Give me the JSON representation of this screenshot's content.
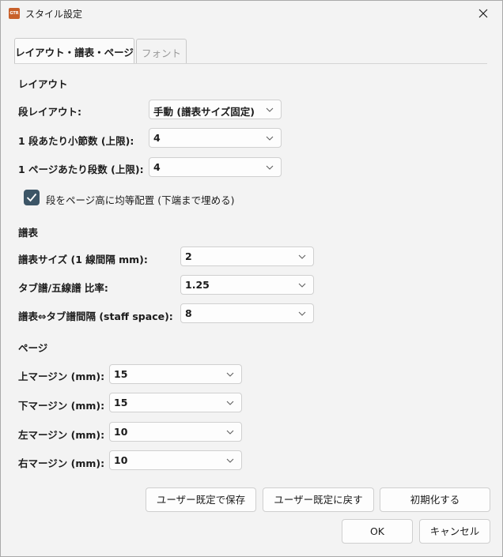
{
  "window": {
    "title": "スタイル設定",
    "app_icon_text": "GTR"
  },
  "tabs": [
    {
      "label": "レイアウト・譜表・ページ",
      "active": true
    },
    {
      "label": "フォント",
      "active": false
    }
  ],
  "layout": {
    "section_title": "レイアウト",
    "stave_layout_label": "段レイアウト:",
    "stave_layout_value": "手動 (譜表サイズ固定)",
    "measures_per_line_label": "1 段あたり小節数 (上限):",
    "measures_per_line_value": "4",
    "lines_per_page_label": "1 ページあたり段数 (上限):",
    "lines_per_page_value": "4",
    "justify_checkbox_label": "段をページ高に均等配置 (下端まで埋める)",
    "justify_checked": true
  },
  "staff": {
    "section_title": "譜表",
    "size_label": "譜表サイズ (1 線間隔 mm):",
    "size_value": "2",
    "ratio_label": "タブ譜/五線譜 比率:",
    "ratio_value": "1.25",
    "gap_label": "譜表⇔タブ譜間隔 (staff space):",
    "gap_value": "8"
  },
  "page": {
    "section_title": "ページ",
    "top_label": "上マージン (mm):",
    "top_value": "15",
    "bottom_label": "下マージン (mm):",
    "bottom_value": "15",
    "left_label": "左マージン (mm):",
    "left_value": "10",
    "right_label": "右マージン (mm):",
    "right_value": "10"
  },
  "buttons": {
    "save_default": "ユーザー既定で保存",
    "restore_default": "ユーザー既定に戻す",
    "reset": "初期化する",
    "ok": "OK",
    "cancel": "キャンセル"
  },
  "colors": {
    "checkbox_fill": "#3c5566",
    "app_icon": "#c8602a"
  }
}
